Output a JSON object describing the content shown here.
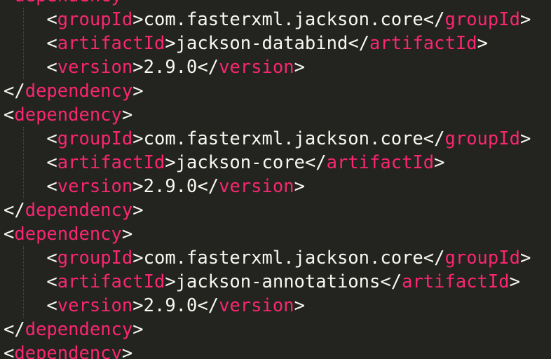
{
  "editor": {
    "lines": [
      {
        "indent": 0,
        "kind": "open",
        "tag": "dependency"
      },
      {
        "indent": 1,
        "kind": "elem",
        "tag": "groupId",
        "value": "com.fasterxml.jackson.core"
      },
      {
        "indent": 1,
        "kind": "elem",
        "tag": "artifactId",
        "value": "jackson-databind"
      },
      {
        "indent": 1,
        "kind": "elem",
        "tag": "version",
        "value": "2.9.0"
      },
      {
        "indent": 0,
        "kind": "close",
        "tag": "dependency"
      },
      {
        "indent": 0,
        "kind": "open",
        "tag": "dependency"
      },
      {
        "indent": 1,
        "kind": "elem",
        "tag": "groupId",
        "value": "com.fasterxml.jackson.core"
      },
      {
        "indent": 1,
        "kind": "elem",
        "tag": "artifactId",
        "value": "jackson-core"
      },
      {
        "indent": 1,
        "kind": "elem",
        "tag": "version",
        "value": "2.9.0"
      },
      {
        "indent": 0,
        "kind": "close",
        "tag": "dependency"
      },
      {
        "indent": 0,
        "kind": "open",
        "tag": "dependency"
      },
      {
        "indent": 1,
        "kind": "elem",
        "tag": "groupId",
        "value": "com.fasterxml.jackson.core"
      },
      {
        "indent": 1,
        "kind": "elem",
        "tag": "artifactId",
        "value": "jackson-annotations"
      },
      {
        "indent": 1,
        "kind": "elem",
        "tag": "version",
        "value": "2.9.0"
      },
      {
        "indent": 0,
        "kind": "close",
        "tag": "dependency"
      },
      {
        "indent": 0,
        "kind": "open",
        "tag": "dependency"
      }
    ],
    "colors": {
      "background": "#23241f",
      "tag": "#f92672",
      "text": "#f8f8f2"
    }
  }
}
